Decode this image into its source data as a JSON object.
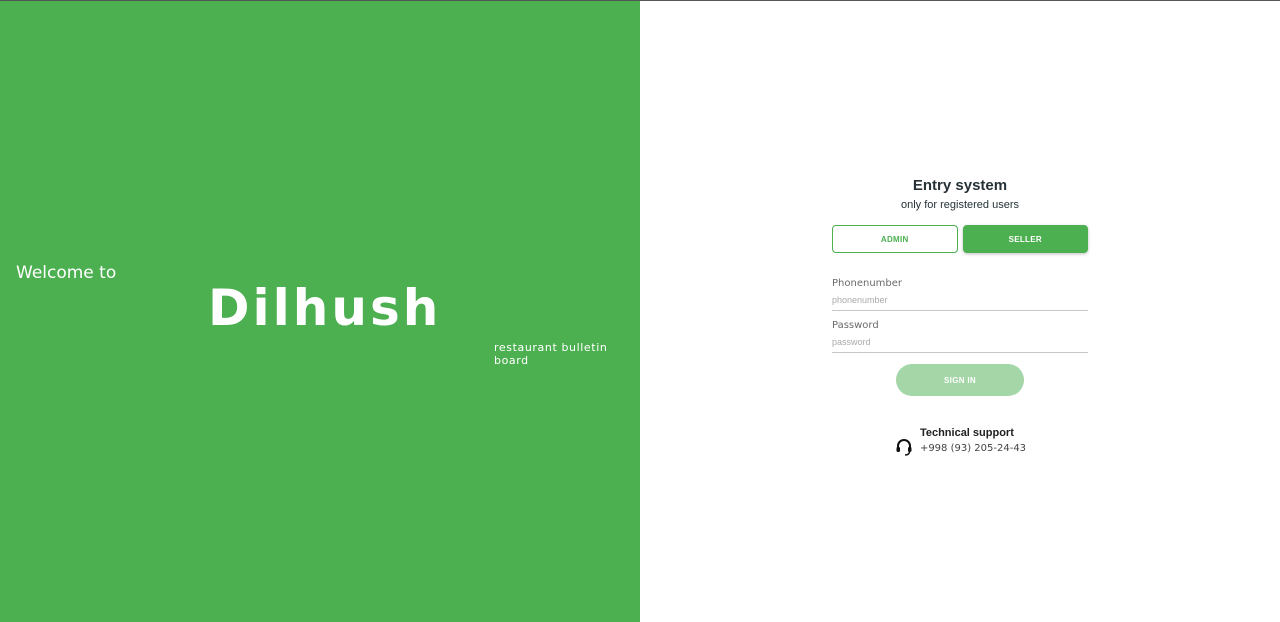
{
  "hero": {
    "welcome": "Welcome to",
    "brand": "Dilhush",
    "tagline": "restaurant bulletin board"
  },
  "login": {
    "title": "Entry system",
    "subtitle": "only for registered users",
    "roles": {
      "admin": "ADMIN",
      "seller": "SELLER",
      "selected": "SELLER"
    },
    "phone": {
      "label": "Phonenumber",
      "placeholder": "phonenumber",
      "value": ""
    },
    "password": {
      "label": "Password",
      "placeholder": "password",
      "value": ""
    },
    "submit_label": "SIGN IN"
  },
  "support": {
    "icon": "headset-icon",
    "title": "Technical support",
    "phone": "+998 (93) 205-24-43"
  },
  "colors": {
    "brand_green": "#4caf50",
    "button_disabled": "#a5d6a7"
  }
}
